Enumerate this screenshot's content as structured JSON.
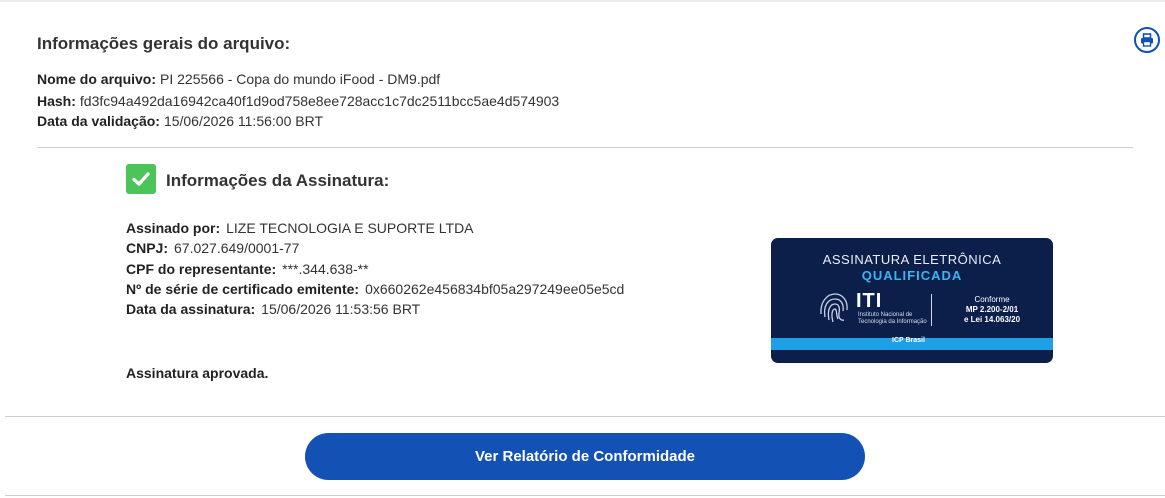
{
  "file": {
    "title": "Informações gerais do arquivo:",
    "name_label": "Nome do arquivo:",
    "name_value": "PI 225566 - Copa do mundo iFood - DM9.pdf",
    "hash_label": "Hash:",
    "hash_value": "fd3fc94a492da16942ca40f1d9od758e8ee728acc1c7dc2511bcc5ae4d574903",
    "date_label": "Data da validação:",
    "date_value": "15/06/2026 11:56:00 BRT"
  },
  "signature": {
    "title": "Informações da Assinatura:",
    "signed_by_label": "Assinado por:",
    "signed_by_value": "LIZE TECNOLOGIA E SUPORTE LTDA",
    "cnpj_label": "CNPJ:",
    "cnpj_value": "67.027.649/0001-77",
    "cpf_label": "CPF do representante:",
    "cpf_value": "***.344.638-**",
    "serial_label": "Nº de série de certificado emitente:",
    "serial_value": "0x660262e456834bf05a297249ee05e5cd",
    "date_label": "Data da assinatura:",
    "date_value": "15/06/2026 11:53:56 BRT",
    "status": "Assinatura aprovada."
  },
  "badge": {
    "line1": "ASSINATURA ELETRÔNICA",
    "line2": "QUALIFICADA",
    "iti": "ITI",
    "iti_sub1": "Instituto Nacional de",
    "iti_sub2": "Tecnologia da Informação",
    "conf1": "Conforme",
    "conf2": "MP 2.200-2/01",
    "conf3": "e Lei 14.063/20",
    "icp": "ICP Brasil"
  },
  "actions": {
    "report_button": "Ver Relatório de Conformidade"
  },
  "icons": {
    "print": "printer-icon",
    "check": "checkmark-icon",
    "fingerprint": "fingerprint-icon"
  },
  "colors": {
    "primary": "#1351b4",
    "success": "#4cc45a",
    "badge_bg": "#0b1f4a",
    "badge_accent": "#3bb4f2"
  }
}
